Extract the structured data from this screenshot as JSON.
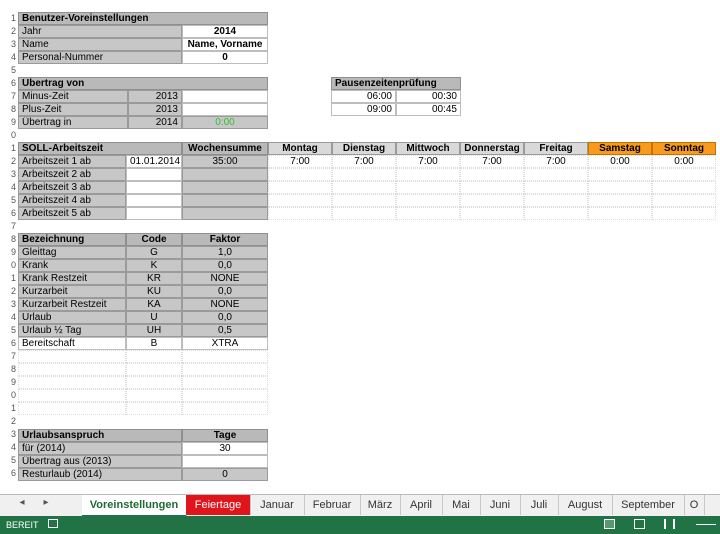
{
  "row_numbers": [
    "1",
    "2",
    "3",
    "4",
    "5",
    "6",
    "7",
    "8",
    "9",
    "0",
    "1",
    "2",
    "3",
    "4",
    "5",
    "6",
    "7",
    "8",
    "9",
    "0",
    "1",
    "2",
    "3",
    "4",
    "5",
    "6",
    "7",
    "8",
    "9",
    "0",
    "1",
    "2",
    "3",
    "4",
    "5",
    "6"
  ],
  "settings": {
    "header": "Benutzer-Voreinstellungen",
    "rows": [
      {
        "label": "Jahr",
        "value": "2014"
      },
      {
        "label": "Name",
        "value": "Name, Vorname"
      },
      {
        "label": "Personal-Nummer",
        "value": "0"
      }
    ]
  },
  "carry": {
    "header": "Übertrag von",
    "rows": [
      {
        "label": "Minus-Zeit",
        "year": "2013",
        "value": ""
      },
      {
        "label": "Plus-Zeit",
        "year": "2013",
        "value": ""
      },
      {
        "label": "Übertrag in",
        "year": "2014",
        "value": "0:00"
      }
    ]
  },
  "pause": {
    "header": "Pausenzeitenprüfung",
    "rows": [
      {
        "a": "06:00",
        "b": "00:30"
      },
      {
        "a": "09:00",
        "b": "00:45"
      }
    ]
  },
  "soll": {
    "header": "SOLL-Arbeitszeit",
    "sum_header": "Wochensumme",
    "days": [
      "Montag",
      "Dienstag",
      "Mittwoch",
      "Donnerstag",
      "Freitag"
    ],
    "weekend": [
      "Samstag",
      "Sonntag"
    ],
    "rows": [
      {
        "label": "Arbeitszeit 1 ab",
        "date": "01.01.2014",
        "sum": "35:00",
        "values": [
          "7:00",
          "7:00",
          "7:00",
          "7:00",
          "7:00",
          "0:00",
          "0:00"
        ]
      },
      {
        "label": "Arbeitszeit 2 ab",
        "date": "",
        "sum": "",
        "values": [
          "",
          "",
          "",
          "",
          "",
          "",
          ""
        ]
      },
      {
        "label": "Arbeitszeit 3 ab",
        "date": "",
        "sum": "",
        "values": [
          "",
          "",
          "",
          "",
          "",
          "",
          ""
        ]
      },
      {
        "label": "Arbeitszeit 4 ab",
        "date": "",
        "sum": "",
        "values": [
          "",
          "",
          "",
          "",
          "",
          "",
          ""
        ]
      },
      {
        "label": "Arbeitszeit 5 ab",
        "date": "",
        "sum": "",
        "values": [
          "",
          "",
          "",
          "",
          "",
          "",
          ""
        ]
      }
    ]
  },
  "codes": {
    "headers": [
      "Bezeichnung",
      "Code",
      "Faktor"
    ],
    "rows": [
      {
        "name": "Gleittag",
        "code": "G",
        "factor": "1,0"
      },
      {
        "name": "Krank",
        "code": "K",
        "factor": "0,0"
      },
      {
        "name": "Krank Restzeit",
        "code": "KR",
        "factor": "NONE"
      },
      {
        "name": "Kurzarbeit",
        "code": "KU",
        "factor": "0,0"
      },
      {
        "name": "Kurzarbeit Restzeit",
        "code": "KA",
        "factor": "NONE"
      },
      {
        "name": "Urlaub",
        "code": "U",
        "factor": "0,0"
      },
      {
        "name": "Urlaub ½ Tag",
        "code": "UH",
        "factor": "0,5"
      },
      {
        "name": "Bereitschaft",
        "code": "B",
        "factor": "XTRA"
      }
    ]
  },
  "vacation": {
    "header": "Urlaubsanspruch",
    "days_header": "Tage",
    "rows": [
      {
        "label": "für (2014)",
        "value": "30"
      },
      {
        "label": "Übertrag aus (2013)",
        "value": ""
      },
      {
        "label": "Resturlaub (2014)",
        "value": "0"
      }
    ]
  },
  "tabs": [
    "Voreinstellungen",
    "Feiertage",
    "Januar",
    "Februar",
    "März",
    "April",
    "Mai",
    "Juni",
    "Juli",
    "August",
    "September",
    "O"
  ],
  "status": {
    "left": "BEREIT"
  },
  "colors": {
    "accent": "#217346",
    "weekend": "#f79a1e",
    "red_tab": "#e0151b",
    "green_value": "#2fbf2f"
  }
}
